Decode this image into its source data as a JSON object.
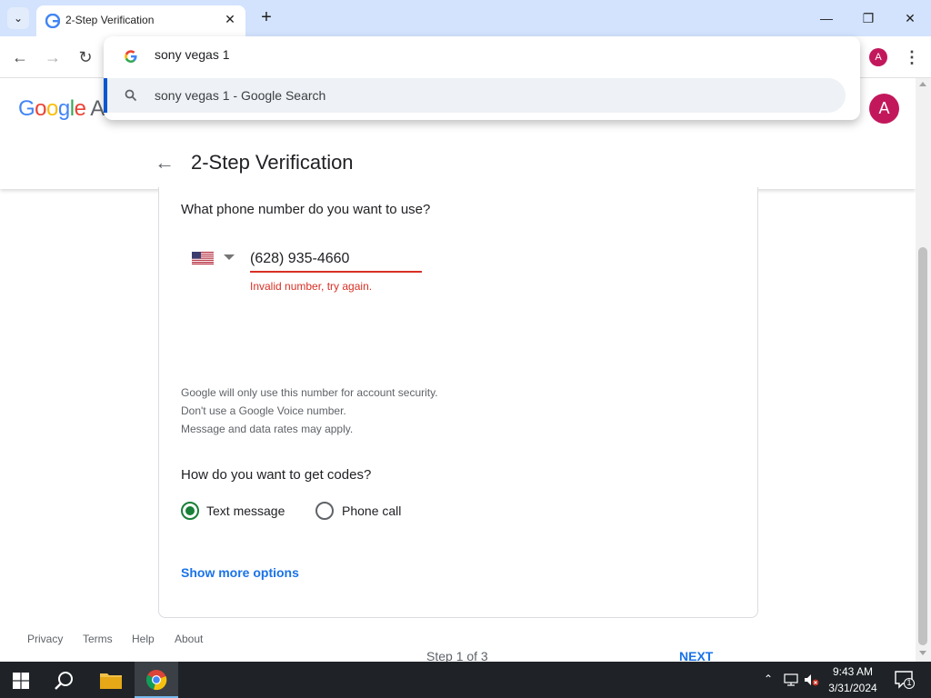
{
  "browser": {
    "tab_title": "2-Step Verification",
    "omnibox_text": "sony vegas 1",
    "suggestion_text": "sony vegas 1 - Google Search",
    "profile_initial": "A"
  },
  "header": {
    "logo_text": "Google A",
    "avatar_initial": "A",
    "page_title": "2-Step Verification"
  },
  "form": {
    "phone_question": "What phone number do you want to use?",
    "phone_value": "(628) 935-4660",
    "phone_error": "Invalid number, try again.",
    "notes": [
      "Google will only use this number for account security.",
      "Don't use a Google Voice number.",
      "Message and data rates may apply."
    ],
    "codes_question": "How do you want to get codes?",
    "option_text_message": "Text message",
    "option_phone_call": "Phone call",
    "selected_option": "Text message",
    "show_more": "Show more options",
    "step_text": "Step 1 of 3",
    "next_label": "NEXT"
  },
  "footer": {
    "links": [
      "Privacy",
      "Terms",
      "Help",
      "About"
    ]
  },
  "taskbar": {
    "time": "9:43 AM",
    "date": "3/31/2024",
    "notification_count": "1"
  },
  "colors": {
    "accent": "#1a73e8",
    "error": "#d93025",
    "radio_selected": "#188038",
    "avatar": "#c2185b"
  }
}
